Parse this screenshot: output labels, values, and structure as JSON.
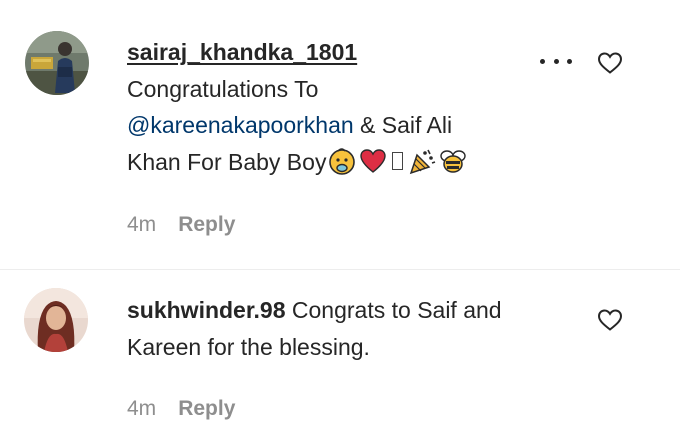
{
  "comments": [
    {
      "username": "sairaj_khandka_1801",
      "text_line1": "Congratulations To",
      "mention": "@kareenakapoorkhan",
      "text_after_mention": " & Saif Ali",
      "text_line3": "Khan For Baby Boy",
      "emojis": [
        "baby-face-icon",
        "red-heart-icon",
        "missing-glyph-icon",
        "party-popper-icon",
        "bee-icon"
      ],
      "time": "4m",
      "reply_label": "Reply"
    },
    {
      "username": "sukhwinder.98",
      "text": " Congrats to Saif and Kareen for the blessing.",
      "time": "4m",
      "reply_label": "Reply"
    }
  ],
  "colors": {
    "text": "#262626",
    "mention": "#00376b",
    "secondary": "#8e8e8e",
    "heart_emoji": "#dd2e44"
  }
}
